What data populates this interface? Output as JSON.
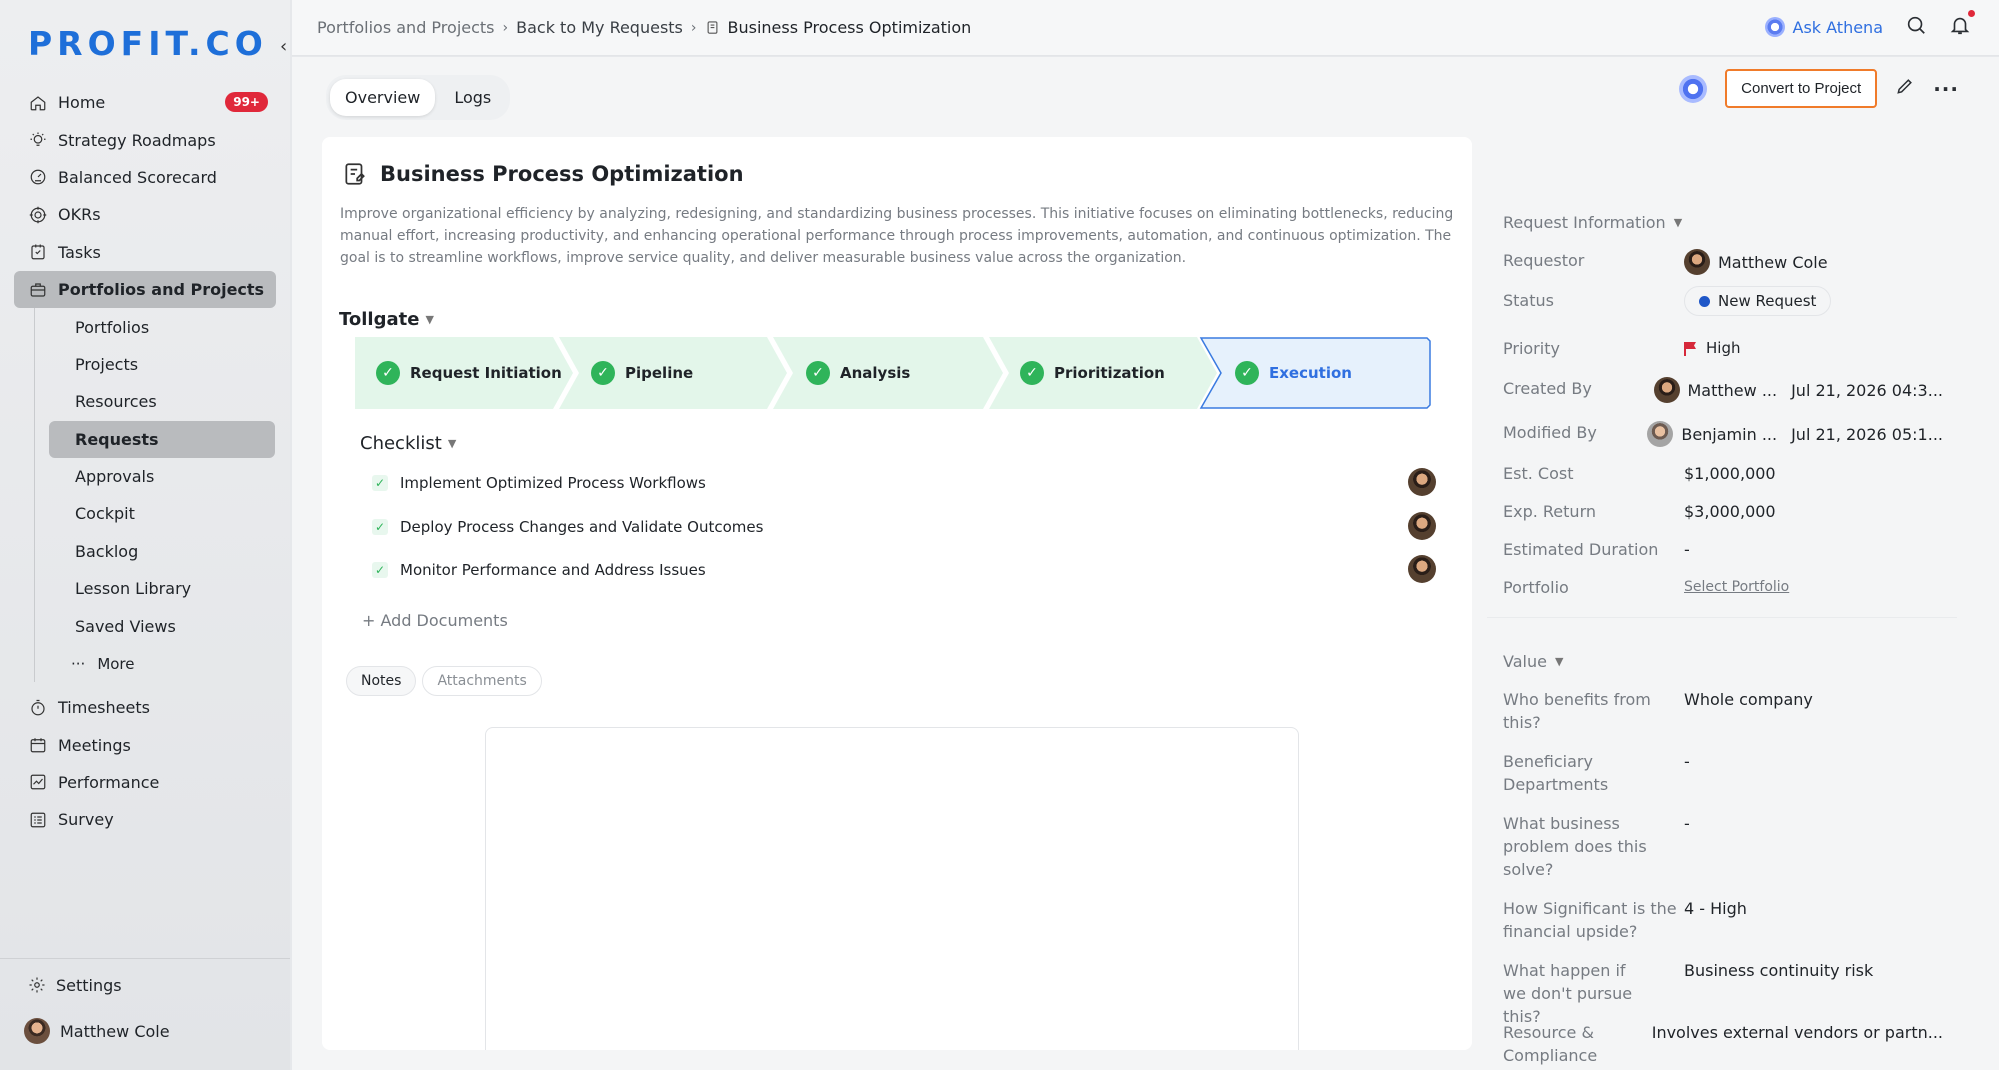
{
  "brand": {
    "logo_text": "PROFIT.CO"
  },
  "sidebar": {
    "home_label": "Home",
    "home_badge": "99+",
    "items": [
      {
        "label": "Strategy Roadmaps"
      },
      {
        "label": "Balanced Scorecard"
      },
      {
        "label": "OKRs"
      },
      {
        "label": "Tasks"
      },
      {
        "label": "Portfolios and Projects"
      }
    ],
    "sub_items": [
      {
        "label": "Portfolios"
      },
      {
        "label": "Projects"
      },
      {
        "label": "Resources"
      },
      {
        "label": "Requests"
      },
      {
        "label": "Approvals"
      },
      {
        "label": "Cockpit"
      },
      {
        "label": "Backlog"
      },
      {
        "label": "Lesson Library"
      },
      {
        "label": "Saved Views"
      },
      {
        "label": "More"
      }
    ],
    "items2": [
      {
        "label": "Timesheets"
      },
      {
        "label": "Meetings"
      },
      {
        "label": "Performance"
      },
      {
        "label": "Survey"
      }
    ],
    "settings_label": "Settings",
    "user_name": "Matthew Cole"
  },
  "breadcrumb": {
    "root": "Portfolios and Projects",
    "back": "Back to My Requests",
    "current": "Business Process Optimization"
  },
  "topbar": {
    "athena_label": "Ask Athena"
  },
  "tabs": {
    "overview": "Overview",
    "logs": "Logs"
  },
  "actions": {
    "convert_label": "Convert to Project"
  },
  "request": {
    "title": "Business Process Optimization",
    "description": "Improve organizational efficiency by analyzing, redesigning, and standardizing business processes. This initiative focuses on eliminating bottlenecks, reducing manual effort, increasing productivity, and enhancing operational performance through process improvements, automation, and continuous optimization. The goal is to streamline workflows, improve service quality, and deliver measurable business value across the organization."
  },
  "tollgate": {
    "heading": "Tollgate",
    "stages": [
      {
        "label": "Request Initiation"
      },
      {
        "label": "Pipeline"
      },
      {
        "label": "Analysis"
      },
      {
        "label": "Prioritization"
      },
      {
        "label": "Execution"
      }
    ]
  },
  "checklist": {
    "heading": "Checklist",
    "items": [
      {
        "label": "Implement Optimized Process Workflows"
      },
      {
        "label": "Deploy Process Changes and Validate Outcomes"
      },
      {
        "label": "Monitor Performance and Address Issues"
      }
    ],
    "add_docs": "+ Add Documents"
  },
  "note_tabs": {
    "notes": "Notes",
    "attachments": "Attachments"
  },
  "request_info": {
    "heading": "Request Information",
    "requestor_label": "Requestor",
    "requestor": "Matthew Cole",
    "status_label": "Status",
    "status": "New Request",
    "priority_label": "Priority",
    "priority": "High",
    "created_by_label": "Created By",
    "created_by": "Matthew ...",
    "created_date": "Jul 21, 2026 04:3...",
    "modified_by_label": "Modified By",
    "modified_by": "Benjamin ...",
    "modified_date": "Jul 21, 2026 05:1...",
    "cost_label": "Est. Cost",
    "cost": "$1,000,000",
    "return_label": "Exp. Return",
    "return": "$3,000,000",
    "duration_label": "Estimated Duration",
    "duration": "-",
    "portfolio_label": "Portfolio",
    "portfolio": "Select Portfolio"
  },
  "value": {
    "heading": "Value",
    "rows": [
      {
        "label": "Who benefits from this?",
        "value": "Whole company"
      },
      {
        "label": "Beneficiary Departments",
        "value": "-"
      },
      {
        "label": "What business problem does this solve?",
        "value": "-"
      },
      {
        "label": "How Significant is the financial upside?",
        "value": "4 - High"
      },
      {
        "label": "What happen if we don't pursue this?",
        "value": "Business continuity risk"
      },
      {
        "label": "Resource & Compliance",
        "value": "Involves external vendors or partn..."
      }
    ]
  },
  "colors": {
    "accent": "#1e6fd9",
    "badge": "#e0283a",
    "success": "#2fb45a",
    "highlight_border": "#f07b2a"
  }
}
